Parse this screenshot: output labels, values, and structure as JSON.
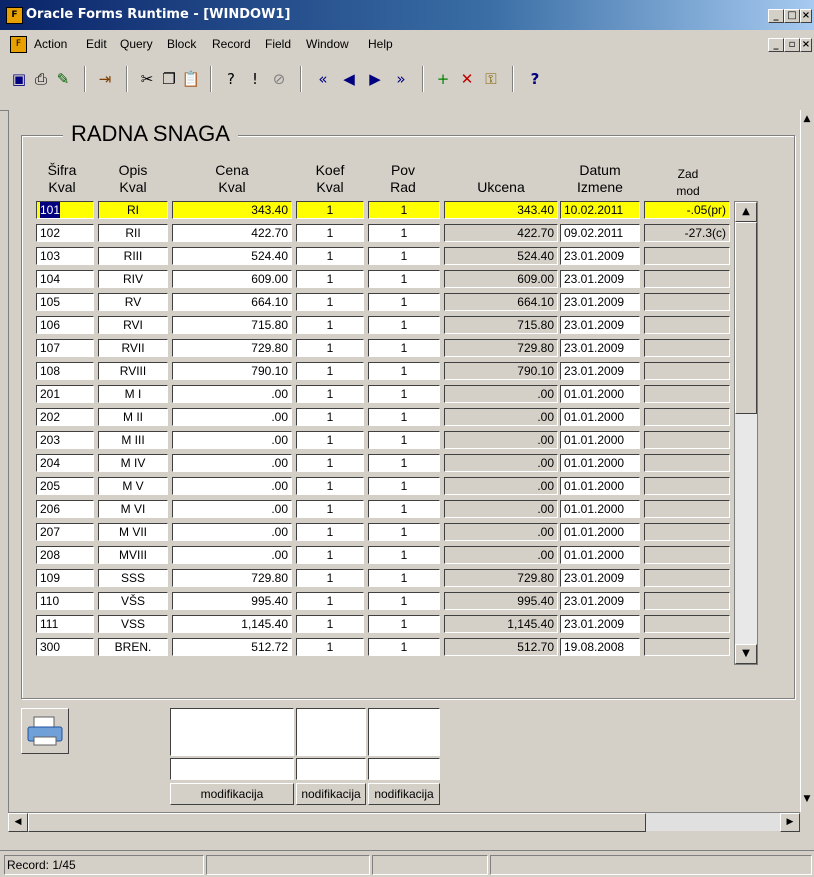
{
  "window": {
    "title": "Oracle Forms Runtime - [WINDOW1]"
  },
  "menu": [
    "Action",
    "Edit",
    "Query",
    "Block",
    "Record",
    "Field",
    "Window",
    "Help"
  ],
  "toolbar": [
    "save-icon",
    "print-icon",
    "clear-icon",
    "exit-icon",
    "cut-icon",
    "copy-icon",
    "paste-icon",
    "enter-query-icon",
    "execute-query-icon",
    "cancel-query-icon",
    "first-record-icon",
    "previous-record-icon",
    "next-record-icon",
    "last-record-icon",
    "insert-record-icon",
    "delete-record-icon",
    "lock-record-icon",
    "help-icon"
  ],
  "form": {
    "title": "RADNA SNAGA",
    "headers": {
      "sifra": [
        "Šifra",
        "Kval"
      ],
      "opis": [
        "Opis",
        "Kval"
      ],
      "cena": [
        "Cena",
        "Kval"
      ],
      "koef": [
        "Koef",
        "Kval"
      ],
      "pov": [
        "Pov",
        "Rad"
      ],
      "ukcena": [
        "",
        "Ukcena"
      ],
      "datum": [
        "Datum",
        "Izmene"
      ],
      "zad": [
        "Zad",
        "mod"
      ]
    },
    "rows": [
      {
        "sifra": "101",
        "opis": "RI",
        "cena": "343.40",
        "koef": "1",
        "pov": "1",
        "ukcena": "343.40",
        "datum": "10.02.2011",
        "zad": "-.05(pr)"
      },
      {
        "sifra": "102",
        "opis": "RII",
        "cena": "422.70",
        "koef": "1",
        "pov": "1",
        "ukcena": "422.70",
        "datum": "09.02.2011",
        "zad": "-27.3(c)"
      },
      {
        "sifra": "103",
        "opis": "RIII",
        "cena": "524.40",
        "koef": "1",
        "pov": "1",
        "ukcena": "524.40",
        "datum": "23.01.2009",
        "zad": ""
      },
      {
        "sifra": "104",
        "opis": "RIV",
        "cena": "609.00",
        "koef": "1",
        "pov": "1",
        "ukcena": "609.00",
        "datum": "23.01.2009",
        "zad": ""
      },
      {
        "sifra": "105",
        "opis": "RV",
        "cena": "664.10",
        "koef": "1",
        "pov": "1",
        "ukcena": "664.10",
        "datum": "23.01.2009",
        "zad": ""
      },
      {
        "sifra": "106",
        "opis": "RVI",
        "cena": "715.80",
        "koef": "1",
        "pov": "1",
        "ukcena": "715.80",
        "datum": "23.01.2009",
        "zad": ""
      },
      {
        "sifra": "107",
        "opis": "RVII",
        "cena": "729.80",
        "koef": "1",
        "pov": "1",
        "ukcena": "729.80",
        "datum": "23.01.2009",
        "zad": ""
      },
      {
        "sifra": "108",
        "opis": "RVIII",
        "cena": "790.10",
        "koef": "1",
        "pov": "1",
        "ukcena": "790.10",
        "datum": "23.01.2009",
        "zad": ""
      },
      {
        "sifra": "201",
        "opis": "M I",
        "cena": ".00",
        "koef": "1",
        "pov": "1",
        "ukcena": ".00",
        "datum": "01.01.2000",
        "zad": ""
      },
      {
        "sifra": "202",
        "opis": "M II",
        "cena": ".00",
        "koef": "1",
        "pov": "1",
        "ukcena": ".00",
        "datum": "01.01.2000",
        "zad": ""
      },
      {
        "sifra": "203",
        "opis": "M III",
        "cena": ".00",
        "koef": "1",
        "pov": "1",
        "ukcena": ".00",
        "datum": "01.01.2000",
        "zad": ""
      },
      {
        "sifra": "204",
        "opis": "M IV",
        "cena": ".00",
        "koef": "1",
        "pov": "1",
        "ukcena": ".00",
        "datum": "01.01.2000",
        "zad": ""
      },
      {
        "sifra": "205",
        "opis": "M V",
        "cena": ".00",
        "koef": "1",
        "pov": "1",
        "ukcena": ".00",
        "datum": "01.01.2000",
        "zad": ""
      },
      {
        "sifra": "206",
        "opis": "M VI",
        "cena": ".00",
        "koef": "1",
        "pov": "1",
        "ukcena": ".00",
        "datum": "01.01.2000",
        "zad": ""
      },
      {
        "sifra": "207",
        "opis": "M VII",
        "cena": ".00",
        "koef": "1",
        "pov": "1",
        "ukcena": ".00",
        "datum": "01.01.2000",
        "zad": ""
      },
      {
        "sifra": "208",
        "opis": "MVIII",
        "cena": ".00",
        "koef": "1",
        "pov": "1",
        "ukcena": ".00",
        "datum": "01.01.2000",
        "zad": ""
      },
      {
        "sifra": "109",
        "opis": "SSS",
        "cena": "729.80",
        "koef": "1",
        "pov": "1",
        "ukcena": "729.80",
        "datum": "23.01.2009",
        "zad": ""
      },
      {
        "sifra": "110",
        "opis": "VŠS",
        "cena": "995.40",
        "koef": "1",
        "pov": "1",
        "ukcena": "995.40",
        "datum": "23.01.2009",
        "zad": ""
      },
      {
        "sifra": "111",
        "opis": "VSS",
        "cena": "1,145.40",
        "koef": "1",
        "pov": "1",
        "ukcena": "1,145.40",
        "datum": "23.01.2009",
        "zad": ""
      },
      {
        "sifra": "300",
        "opis": "BREN.",
        "cena": "512.72",
        "koef": "1",
        "pov": "1",
        "ukcena": "512.70",
        "datum": "19.08.2008",
        "zad": ""
      }
    ],
    "buttons": [
      "modifikacija",
      "nodifikacija",
      "nodifikacija"
    ]
  },
  "status": {
    "record": "Record: 1/45"
  },
  "colors": {
    "current_row": "#ffff00",
    "readonly": "#d4d0c8",
    "titlebar": "#0a246a"
  }
}
